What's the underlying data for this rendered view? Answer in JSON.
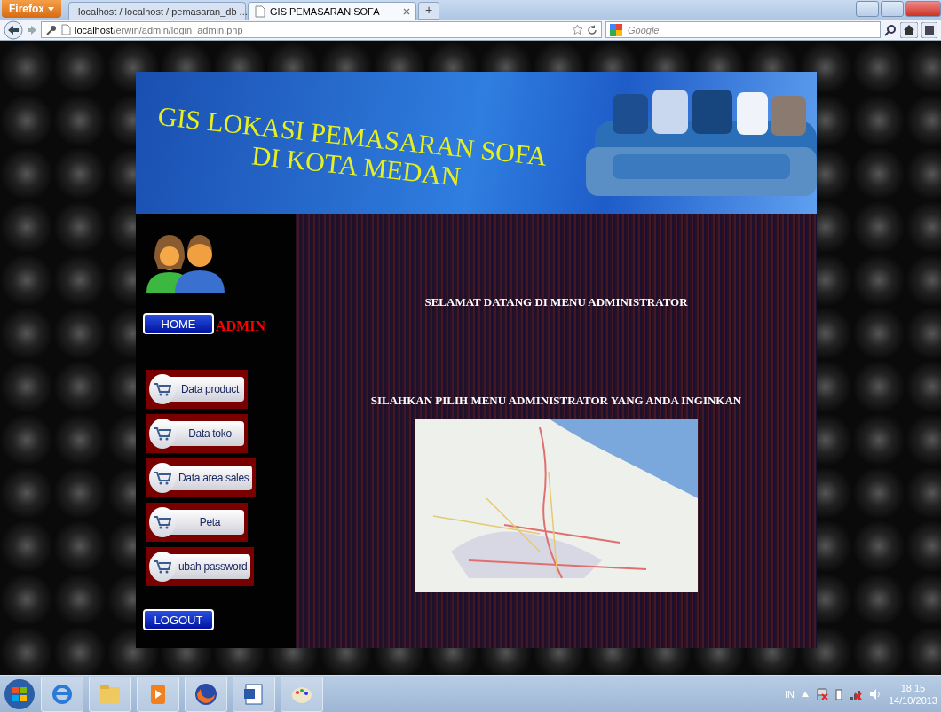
{
  "browser": {
    "menu_button": "Firefox",
    "tabs": [
      {
        "label": "localhost / localhost / pemasaran_db ...",
        "selected": false
      },
      {
        "label": "GIS PEMASARAN SOFA",
        "selected": true
      }
    ],
    "new_tab": "+",
    "url": {
      "host": "localhost",
      "path": "/erwin/admin/login_admin.php"
    },
    "search": {
      "placeholder": "Google"
    }
  },
  "page": {
    "banner": {
      "title": "GIS LOKASI PEMASARAN SOFA",
      "subtitle": "DI KOTA MEDAN"
    },
    "home_button": "HOME",
    "role_label": "ADMIN",
    "menu": [
      "Data product",
      "Data toko",
      "Data area sales",
      "Peta",
      "ubah password"
    ],
    "logout_button": "LOGOUT",
    "welcome": "SELAMAT DATANG DI MENU ADMINISTRATOR",
    "instruction": "SILAHKAN PILIH MENU ADMINISTRATOR YANG ANDA INGINKAN"
  },
  "taskbar": {
    "language": "IN",
    "time": "18:15",
    "date": "14/10/2013"
  }
}
